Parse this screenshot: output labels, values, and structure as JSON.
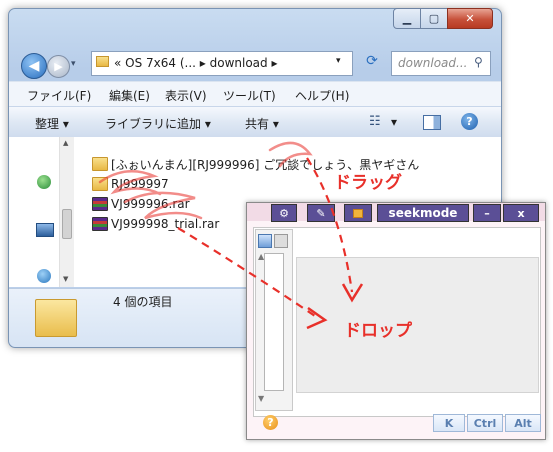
{
  "explorer": {
    "address_path": "«  OS 7x64 (...  ▸  download  ▸",
    "search_placeholder": "download...",
    "menu": [
      "ファイル(F)",
      "編集(E)",
      "表示(V)",
      "ツール(T)",
      "ヘルプ(H)"
    ],
    "toolbar": {
      "organize": "整理 ▾",
      "add_to_library": "ライブラリに追加 ▾",
      "share": "共有 ▾",
      "view": "▾"
    },
    "files": [
      {
        "name": "[ふぉいんまん][RJ999996] ご冗談でしょう、黒ヤギさん",
        "kind": "folder"
      },
      {
        "name": "RJ999997",
        "kind": "folder"
      },
      {
        "name": "VJ999996.rar",
        "kind": "rar"
      },
      {
        "name": "VJ999998_trial.rar",
        "kind": "rar"
      }
    ],
    "item_count": "4 個の項目"
  },
  "seekmode": {
    "title": "seekmode",
    "min_label": "–",
    "close_label": "x",
    "keys": [
      "K",
      "Ctrl",
      "Alt"
    ],
    "help_label": "?"
  },
  "annotations": {
    "drag": "ドラッグ",
    "drop": "ドロップ"
  },
  "colors": {
    "annotation": "#e8302a",
    "titlebar_button": "#5b4f96"
  }
}
